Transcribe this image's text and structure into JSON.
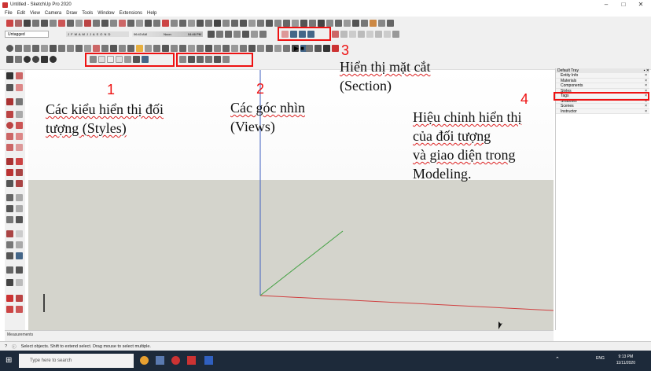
{
  "window": {
    "title": "Untitled - SketchUp Pro 2020",
    "min": "–",
    "max": "□",
    "close": "✕"
  },
  "menu": [
    "File",
    "Edit",
    "View",
    "Camera",
    "Draw",
    "Tools",
    "Window",
    "Extensions",
    "Help"
  ],
  "toolbar": {
    "layer_value": "Untagged",
    "months": "J F M A M J J A S O N D",
    "time_start": "06:43 AM",
    "time_mid": "Noon",
    "time_end": "04:46 PM"
  },
  "annotations": {
    "n1": "1",
    "n2": "2",
    "n3": "3",
    "n4": "4",
    "styles_line1": "Các kiểu hiển thị đối",
    "styles_line2": "tượng (Styles)",
    "views_line1": "Các góc nhìn",
    "views_line2": "(Views)",
    "section_line1": "Hiển thị mặt cắt",
    "section_line2": "(Section)",
    "tray_line1": "Hiệu chỉnh hiển thị",
    "tray_line2": "của đối tượng",
    "tray_line3": "và giao diện trong",
    "tray_line4": "Modeling."
  },
  "tray": {
    "title": "Default Tray",
    "items": [
      "Entity Info",
      "Materials",
      "Components",
      "Styles",
      "Tags",
      "Shadows",
      "Scenes",
      "Instructor"
    ]
  },
  "measurements_label": "Measurements",
  "status_text": "Select objects. Shift to extend select. Drag mouse to select multiple.",
  "taskbar": {
    "search_placeholder": "Type here to search",
    "lang": "ENG",
    "time": "9:13 PM",
    "date": "11/11/2020"
  },
  "colors": {
    "annotation_red": "#e11111",
    "ground": "#d4d4cc",
    "axis_red": "#d04040",
    "axis_green": "#40a040",
    "axis_blue": "#4060c0"
  }
}
